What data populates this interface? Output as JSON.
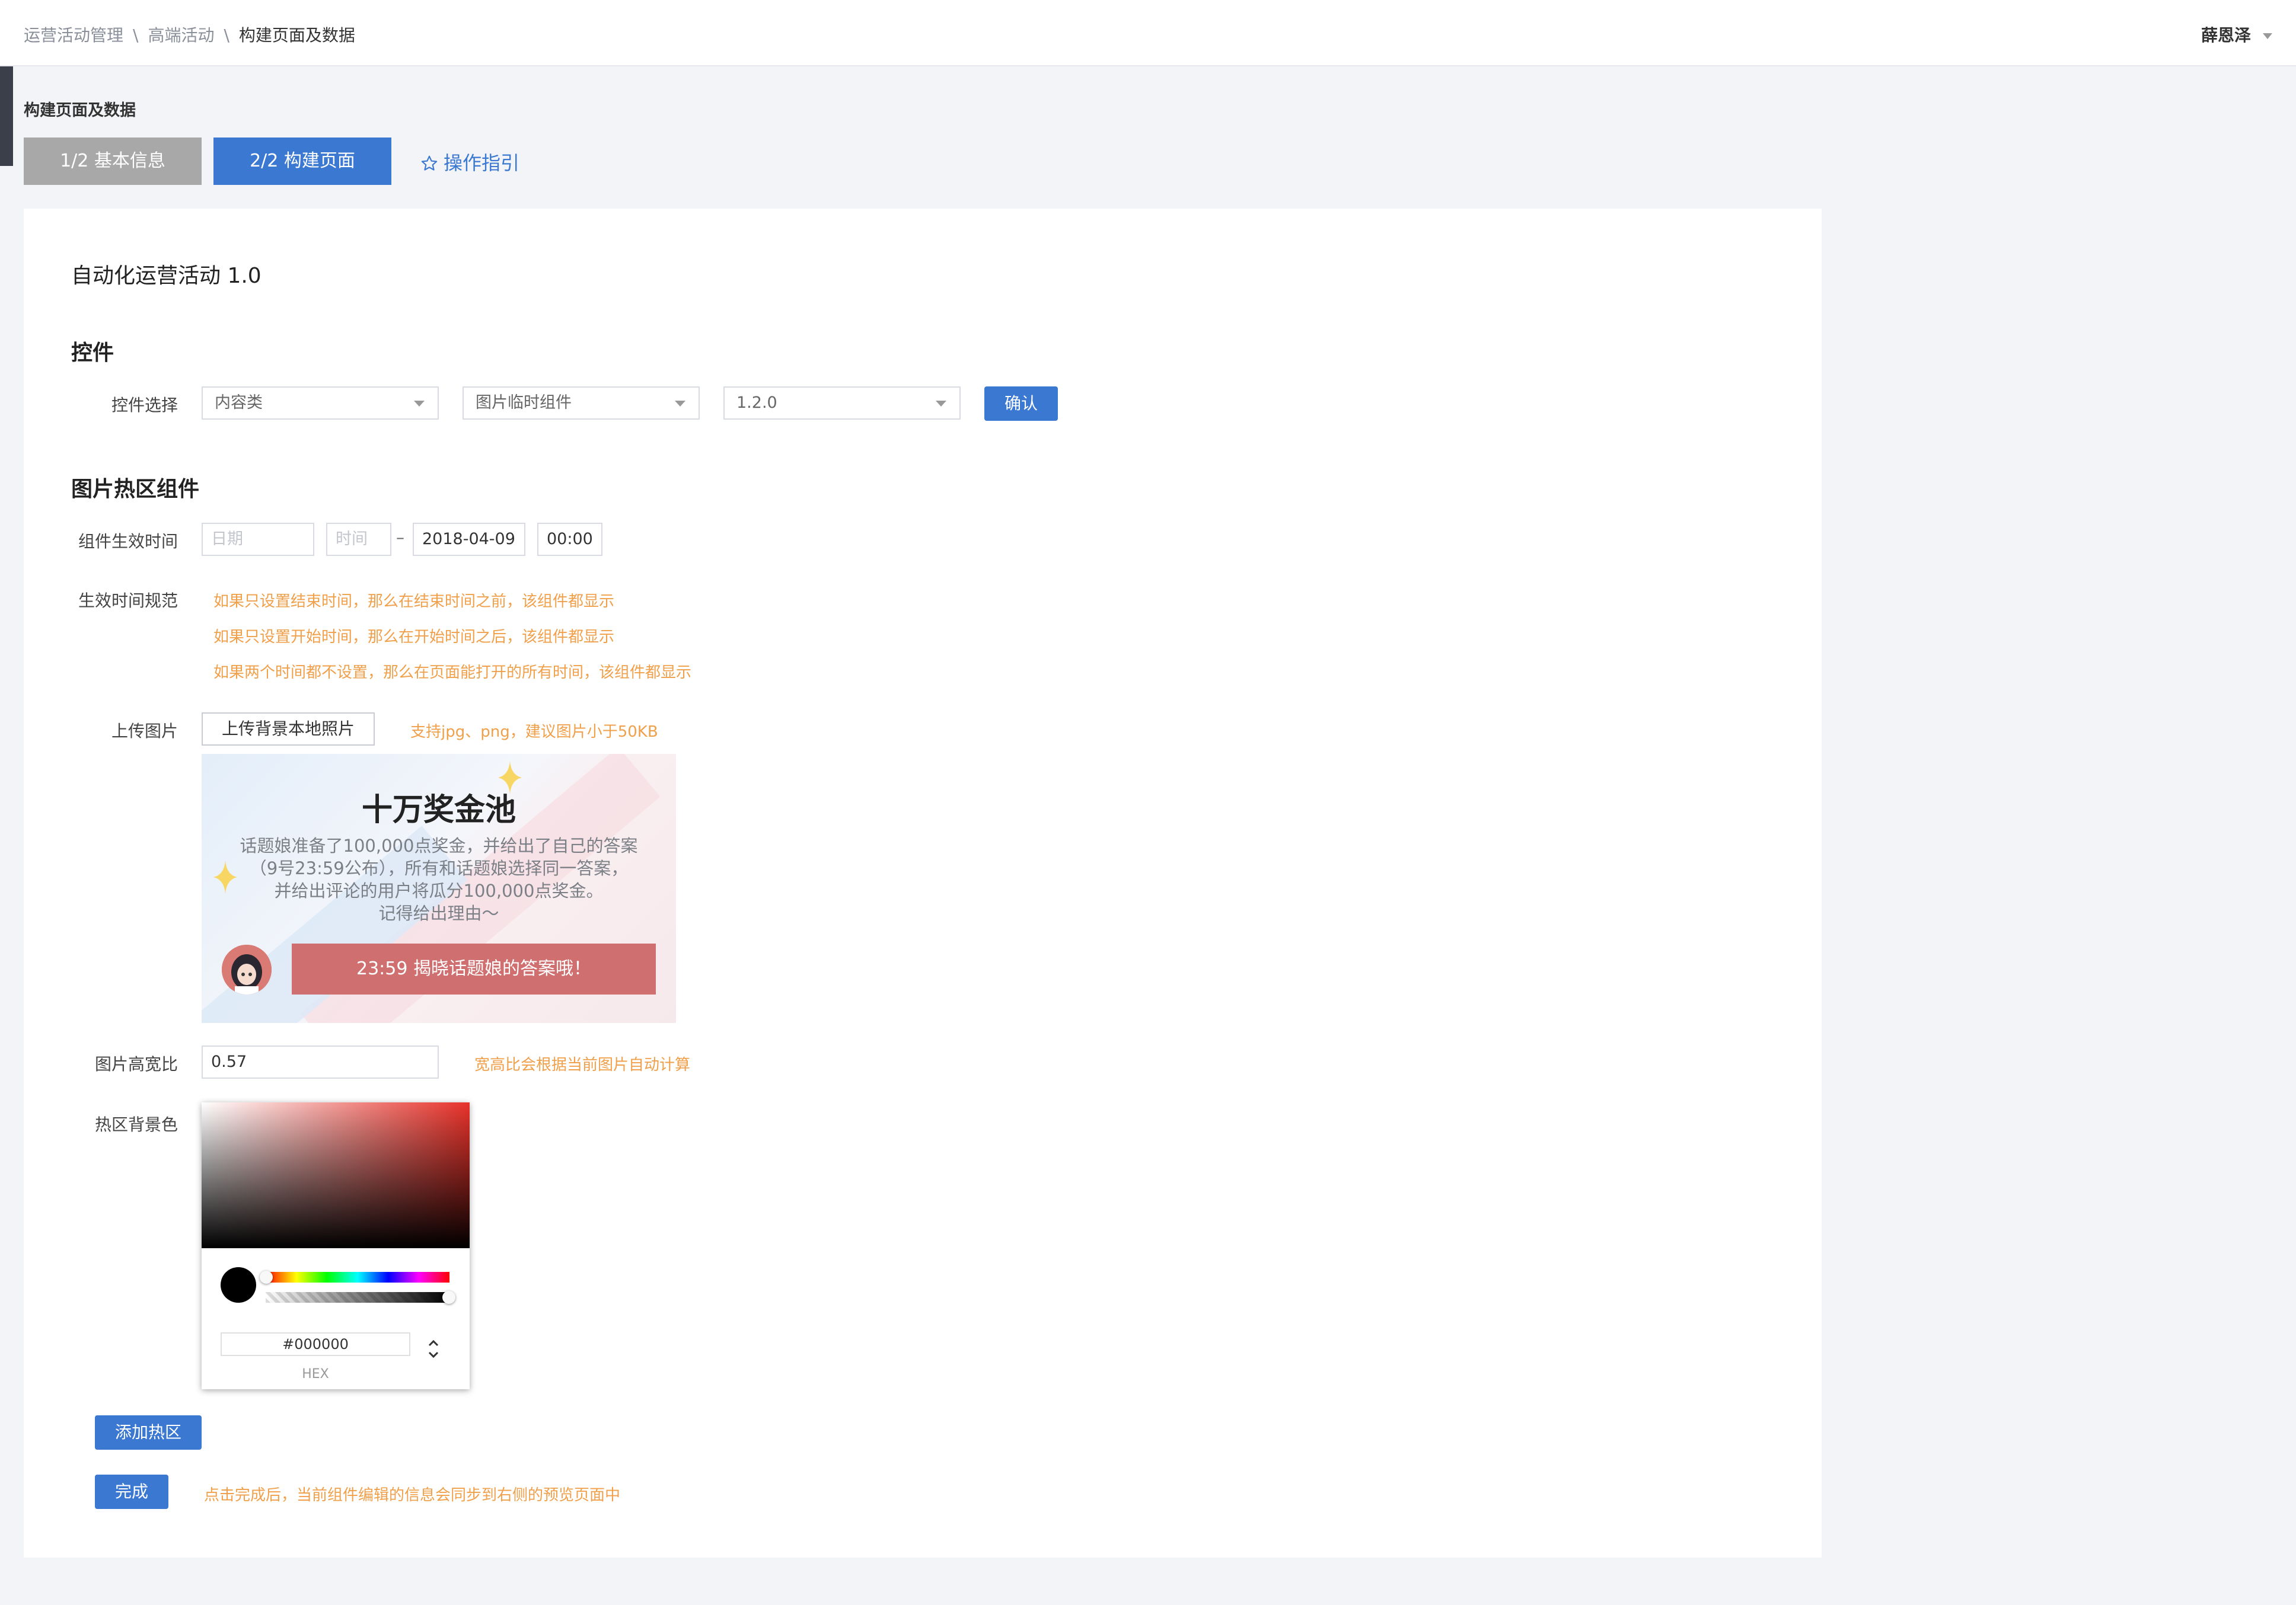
{
  "header": {
    "breadcrumb": [
      "运营活动管理",
      "高端活动",
      "构建页面及数据"
    ],
    "separator": "\\",
    "user_name": "薛恩泽"
  },
  "page": {
    "title": "构建页面及数据",
    "steps": [
      {
        "label": "1/2 基本信息",
        "active": false
      },
      {
        "label": "2/2 构建页面",
        "active": true
      }
    ],
    "guide_label": "操作指引"
  },
  "panel": {
    "heading": "自动化运营活动 1.0",
    "controls_section": {
      "title": "控件",
      "select_label": "控件选择",
      "selects": [
        "内容类",
        "图片临时组件",
        "1.2.0"
      ],
      "confirm_label": "确认"
    },
    "hotspot_section": {
      "title": "图片热区组件",
      "time_label": "组件生效时间",
      "start_date_placeholder": "日期",
      "start_time_placeholder": "时间",
      "range_separator": "–",
      "end_date": "2018-04-09",
      "end_time": "00:00",
      "rule_label": "生效时间规范",
      "rules": [
        "如果只设置结束时间，那么在结束时间之前，该组件都显示",
        "如果只设置开始时间，那么在开始时间之后，该组件都显示",
        "如果两个时间都不设置，那么在页面能打开的所有时间，该组件都显示"
      ],
      "upload_label": "上传图片",
      "upload_button": "上传背景本地照片",
      "upload_hint": "支持jpg、png，建议图片小于50KB",
      "banner": {
        "title": "十万奖金池",
        "lines": [
          "话题娘准备了100,000点奖金，并给出了自己的答案",
          "（9号23:59公布），所有和话题娘选择同一答案，",
          "并给出评论的用户将瓜分100,000点奖金。",
          "记得给出理由～"
        ],
        "cta": "23:59 揭晓话题娘的答案哦！"
      },
      "ratio_label": "图片高宽比",
      "ratio_value": "0.57",
      "ratio_hint": "宽高比会根据当前图片自动计算",
      "bg_label": "热区背景色",
      "color_picker": {
        "hex_value": "#000000",
        "mode_label": "HEX",
        "selected_color": "#000000",
        "base_hue_color": "#e8322a"
      },
      "add_hotspot_label": "添加热区",
      "done_label": "完成",
      "done_hint": "点击完成后，当前组件编辑的信息会同步到右侧的预览页面中"
    }
  },
  "colors": {
    "primary": "#3a78d1",
    "hint": "#f0a04b",
    "step_inactive": "#a8a8a8",
    "banner_cta": "#cf6f6f"
  }
}
